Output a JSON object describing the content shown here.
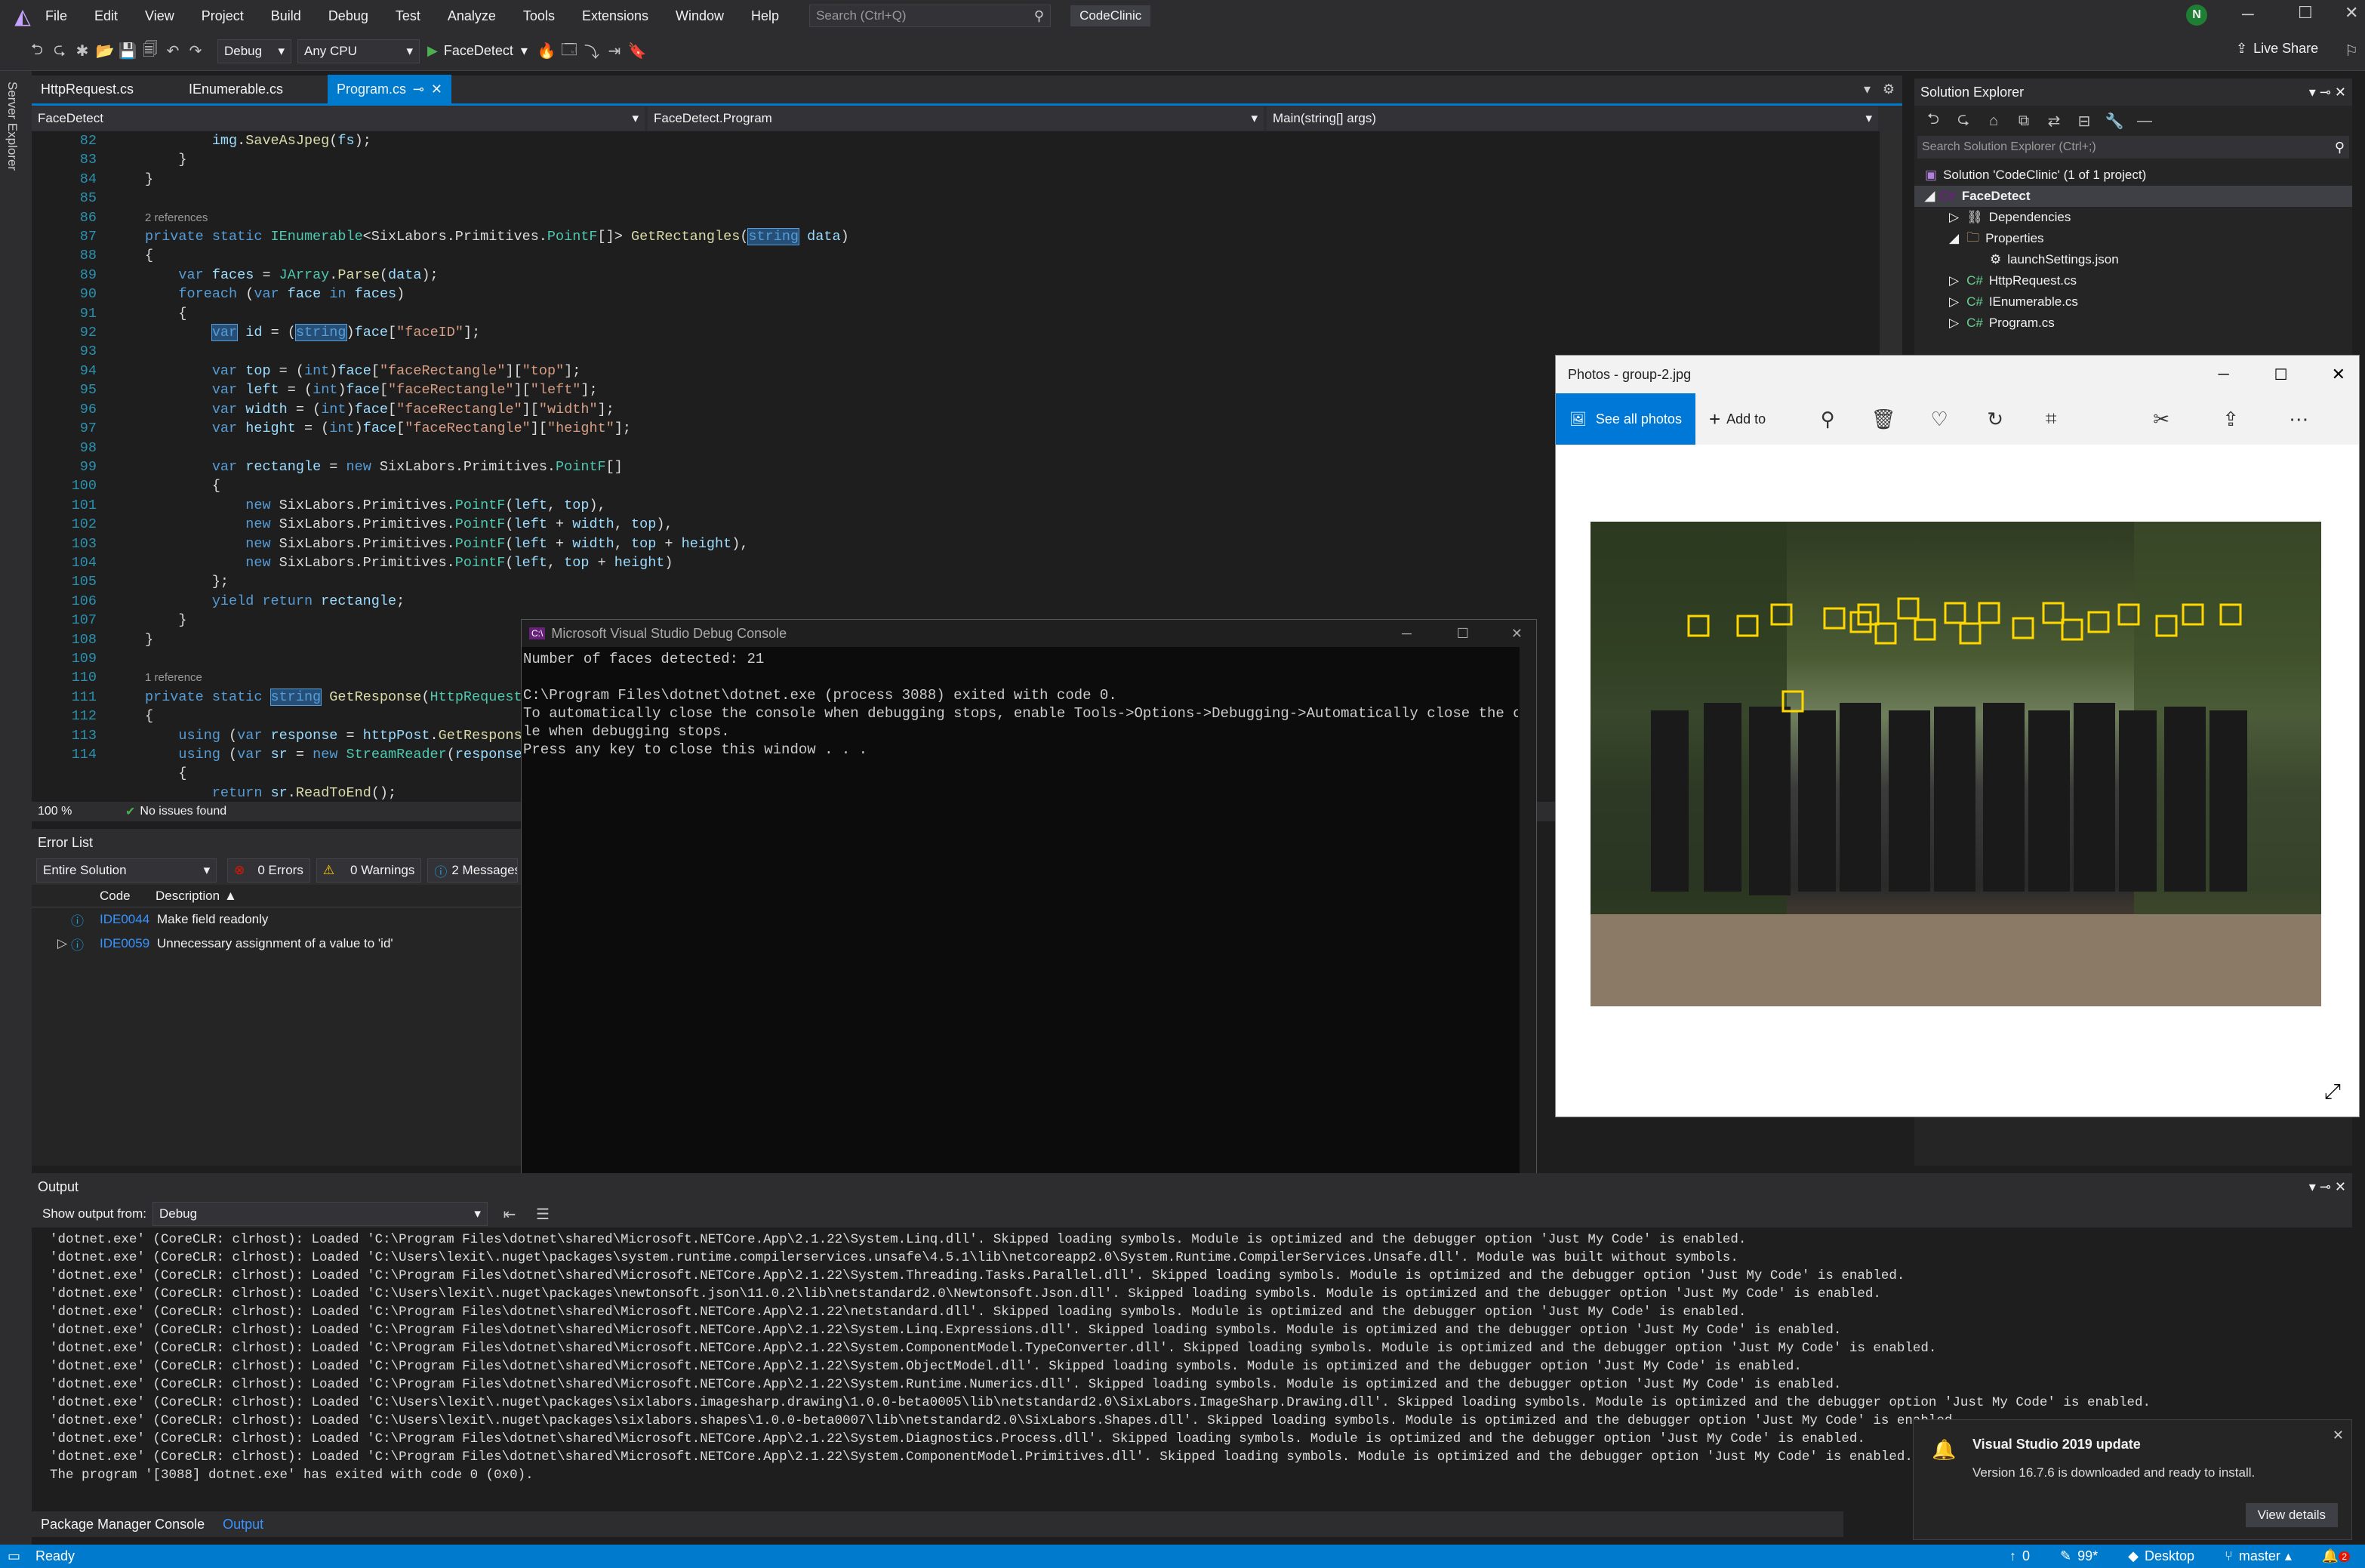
{
  "menu": [
    "File",
    "Edit",
    "View",
    "Project",
    "Build",
    "Debug",
    "Test",
    "Analyze",
    "Tools",
    "Extensions",
    "Window",
    "Help"
  ],
  "search": {
    "placeholder": "Search (Ctrl+Q)"
  },
  "app_title": "CodeClinic",
  "user_initial": "N",
  "live_share": "Live Share",
  "toolbar": {
    "config": "Debug",
    "platform": "Any CPU",
    "run": "FaceDetect"
  },
  "tabs": [
    "HttpRequest.cs",
    "IEnumerable.cs",
    "Program.cs"
  ],
  "nav": {
    "project": "FaceDetect",
    "class": "FaceDetect.Program",
    "member": "Main(string[] args)"
  },
  "side_tab": "Server Explorer",
  "code": {
    "refs2": "2 references",
    "refs1": "1 reference",
    "lines": [
      "82",
      "83",
      "84",
      "85",
      "86",
      "87",
      "88",
      "89",
      "90",
      "91",
      "92",
      "93",
      "94",
      "95",
      "96",
      "97",
      "98",
      "99",
      "100",
      "101",
      "102",
      "103",
      "104",
      "105",
      "106",
      "107",
      "108",
      "109",
      "110",
      "111",
      "112",
      "113",
      "114"
    ]
  },
  "editor_status": {
    "zoom": "100 %",
    "issues": "No issues found"
  },
  "error_list": {
    "title": "Error List",
    "scope": "Entire Solution",
    "errors": "0 Errors",
    "warnings": "0 Warnings",
    "messages": "2 Messages",
    "col_code": "Code",
    "col_desc": "Description",
    "rows": [
      {
        "code": "IDE0044",
        "desc": "Make field readonly"
      },
      {
        "code": "IDE0059",
        "desc": "Unnecessary assignment of a value to 'id'"
      }
    ]
  },
  "solution": {
    "title": "Solution Explorer",
    "search": "Search Solution Explorer (Ctrl+;)",
    "items": [
      "Solution 'CodeClinic' (1 of 1 project)",
      "FaceDetect",
      "Dependencies",
      "Properties",
      "launchSettings.json",
      "HttpRequest.cs",
      "IEnumerable.cs",
      "Program.cs"
    ]
  },
  "photos": {
    "title": "Photos - group-2.jpg",
    "see_all": "See all photos",
    "add_to": "Add to"
  },
  "console": {
    "title": "Microsoft Visual Studio Debug Console",
    "lines": [
      "Number of faces detected: 21",
      "",
      "C:\\Program Files\\dotnet\\dotnet.exe (process 3088) exited with code 0.",
      "To automatically close the console when debugging stops, enable Tools->Options->Debugging->Automatically close the conso",
      "le when debugging stops.",
      "Press any key to close this window . . ."
    ]
  },
  "output": {
    "title": "Output",
    "show_from": "Show output from:",
    "source": "Debug",
    "lines": [
      "'dotnet.exe' (CoreCLR: clrhost): Loaded 'C:\\Program Files\\dotnet\\shared\\Microsoft.NETCore.App\\2.1.22\\System.Linq.dll'. Skipped loading symbols. Module is optimized and the debugger option 'Just My Code' is enabled.",
      "'dotnet.exe' (CoreCLR: clrhost): Loaded 'C:\\Users\\lexit\\.nuget\\packages\\system.runtime.compilerservices.unsafe\\4.5.1\\lib\\netcoreapp2.0\\System.Runtime.CompilerServices.Unsafe.dll'. Module was built without symbols.",
      "'dotnet.exe' (CoreCLR: clrhost): Loaded 'C:\\Program Files\\dotnet\\shared\\Microsoft.NETCore.App\\2.1.22\\System.Threading.Tasks.Parallel.dll'. Skipped loading symbols. Module is optimized and the debugger option 'Just My Code' is enabled.",
      "'dotnet.exe' (CoreCLR: clrhost): Loaded 'C:\\Users\\lexit\\.nuget\\packages\\newtonsoft.json\\11.0.2\\lib\\netstandard2.0\\Newtonsoft.Json.dll'. Skipped loading symbols. Module is optimized and the debugger option 'Just My Code' is enabled.",
      "'dotnet.exe' (CoreCLR: clrhost): Loaded 'C:\\Program Files\\dotnet\\shared\\Microsoft.NETCore.App\\2.1.22\\netstandard.dll'. Skipped loading symbols. Module is optimized and the debugger option 'Just My Code' is enabled.",
      "'dotnet.exe' (CoreCLR: clrhost): Loaded 'C:\\Program Files\\dotnet\\shared\\Microsoft.NETCore.App\\2.1.22\\System.Linq.Expressions.dll'. Skipped loading symbols. Module is optimized and the debugger option 'Just My Code' is enabled.",
      "'dotnet.exe' (CoreCLR: clrhost): Loaded 'C:\\Program Files\\dotnet\\shared\\Microsoft.NETCore.App\\2.1.22\\System.ComponentModel.TypeConverter.dll'. Skipped loading symbols. Module is optimized and the debugger option 'Just My Code' is enabled.",
      "'dotnet.exe' (CoreCLR: clrhost): Loaded 'C:\\Program Files\\dotnet\\shared\\Microsoft.NETCore.App\\2.1.22\\System.ObjectModel.dll'. Skipped loading symbols. Module is optimized and the debugger option 'Just My Code' is enabled.",
      "'dotnet.exe' (CoreCLR: clrhost): Loaded 'C:\\Program Files\\dotnet\\shared\\Microsoft.NETCore.App\\2.1.22\\System.Runtime.Numerics.dll'. Skipped loading symbols. Module is optimized and the debugger option 'Just My Code' is enabled.",
      "'dotnet.exe' (CoreCLR: clrhost): Loaded 'C:\\Users\\lexit\\.nuget\\packages\\sixlabors.imagesharp.drawing\\1.0.0-beta0005\\lib\\netstandard2.0\\SixLabors.ImageSharp.Drawing.dll'. Skipped loading symbols. Module is optimized and the debugger option 'Just My Code' is enabled.",
      "'dotnet.exe' (CoreCLR: clrhost): Loaded 'C:\\Users\\lexit\\.nuget\\packages\\sixlabors.shapes\\1.0.0-beta0007\\lib\\netstandard2.0\\SixLabors.Shapes.dll'. Skipped loading symbols. Module is optimized and the debugger option 'Just My Code' is enabled.",
      "'dotnet.exe' (CoreCLR: clrhost): Loaded 'C:\\Program Files\\dotnet\\shared\\Microsoft.NETCore.App\\2.1.22\\System.Diagnostics.Process.dll'. Skipped loading symbols. Module is optimized and the debugger option 'Just My Code' is enabled.",
      "'dotnet.exe' (CoreCLR: clrhost): Loaded 'C:\\Program Files\\dotnet\\shared\\Microsoft.NETCore.App\\2.1.22\\System.ComponentModel.Primitives.dll'. Skipped loading symbols. Module is optimized and the debugger option 'Just My Code' is enabled.",
      "The program '[3088] dotnet.exe' has exited with code 0 (0x0)."
    ]
  },
  "bottom_tabs": [
    "Package Manager Console",
    "Output"
  ],
  "toast": {
    "title": "Visual Studio 2019 update",
    "body": "Version 16.7.6 is downloaded and ready to install.",
    "button": "View details"
  },
  "status": {
    "ready": "Ready",
    "up": "0",
    "pencil": "99*",
    "repo": "Desktop",
    "branch": "master",
    "bell": "2"
  },
  "colors": {
    "accent": "#007acc",
    "bg": "#1e1e1e",
    "chrome": "#2d2d30"
  }
}
